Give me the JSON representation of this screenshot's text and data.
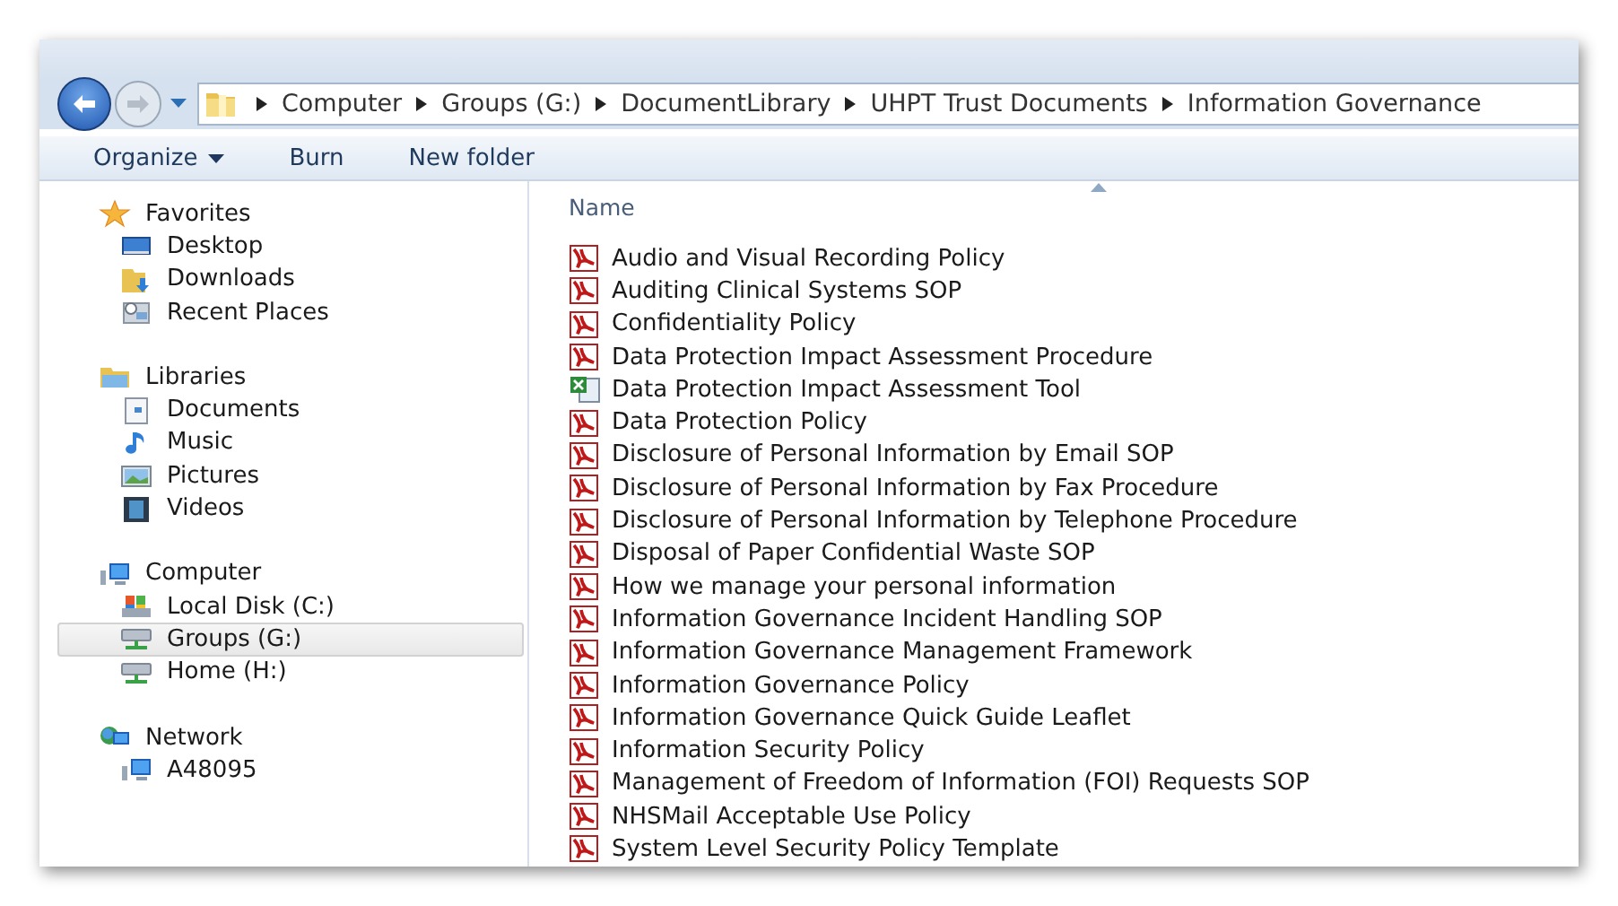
{
  "navigation": {
    "back": true,
    "forward": false
  },
  "address_bar": {
    "crumbs": [
      "Computer",
      "Groups (G:)",
      "DocumentLibrary",
      "UHPT Trust Documents",
      "Information Governance"
    ]
  },
  "toolbar": [
    {
      "label": "Organize",
      "dropdown": true
    },
    {
      "label": "Burn",
      "dropdown": false
    },
    {
      "label": "New folder",
      "dropdown": false
    }
  ],
  "sidebar": [
    {
      "label": "Favorites",
      "kind": "star",
      "selected": false,
      "children": [
        {
          "label": "Desktop",
          "kind": "desktop",
          "selected": false
        },
        {
          "label": "Downloads",
          "kind": "downloads",
          "selected": false
        },
        {
          "label": "Recent Places",
          "kind": "recent",
          "selected": false
        }
      ]
    },
    {
      "label": "Libraries",
      "kind": "library",
      "selected": false,
      "children": [
        {
          "label": "Documents",
          "kind": "documents",
          "selected": false
        },
        {
          "label": "Music",
          "kind": "music",
          "selected": false
        },
        {
          "label": "Pictures",
          "kind": "pictures",
          "selected": false
        },
        {
          "label": "Videos",
          "kind": "videos",
          "selected": false
        }
      ]
    },
    {
      "label": "Computer",
      "kind": "computer",
      "selected": false,
      "children": [
        {
          "label": "Local Disk (C:)",
          "kind": "disk",
          "selected": false
        },
        {
          "label": "Groups (G:)",
          "kind": "netdrive",
          "selected": true
        },
        {
          "label": "Home (H:)",
          "kind": "netdrive",
          "selected": false
        }
      ]
    },
    {
      "label": "Network",
      "kind": "network",
      "selected": false,
      "children": [
        {
          "label": "A48095",
          "kind": "computer",
          "selected": false
        }
      ]
    }
  ],
  "file_list": {
    "columns": [
      {
        "label": "Name",
        "sorted": true
      }
    ],
    "rows": [
      {
        "name": "Audio and Visual Recording Policy",
        "kind": "pdf"
      },
      {
        "name": "Auditing Clinical Systems SOP",
        "kind": "pdf"
      },
      {
        "name": "Confidentiality Policy",
        "kind": "pdf"
      },
      {
        "name": "Data Protection Impact Assessment Procedure",
        "kind": "pdf"
      },
      {
        "name": "Data Protection Impact Assessment Tool",
        "kind": "excel"
      },
      {
        "name": "Data Protection Policy",
        "kind": "pdf"
      },
      {
        "name": "Disclosure of Personal Information by Email SOP",
        "kind": "pdf"
      },
      {
        "name": "Disclosure of Personal Information by Fax Procedure",
        "kind": "pdf"
      },
      {
        "name": "Disclosure of Personal Information by Telephone Procedure",
        "kind": "pdf"
      },
      {
        "name": "Disposal of Paper Confidential Waste SOP",
        "kind": "pdf"
      },
      {
        "name": "How we manage your personal information",
        "kind": "pdf"
      },
      {
        "name": "Information Governance Incident Handling SOP",
        "kind": "pdf"
      },
      {
        "name": "Information Governance Management Framework",
        "kind": "pdf"
      },
      {
        "name": "Information Governance Policy",
        "kind": "pdf"
      },
      {
        "name": "Information Governance Quick Guide Leaflet",
        "kind": "pdf"
      },
      {
        "name": "Information Security Policy",
        "kind": "pdf"
      },
      {
        "name": "Management of Freedom of Information (FOI) Requests SOP",
        "kind": "pdf"
      },
      {
        "name": "NHSMail Acceptable Use Policy",
        "kind": "pdf"
      },
      {
        "name": "System Level Security Policy Template",
        "kind": "pdf"
      }
    ]
  }
}
